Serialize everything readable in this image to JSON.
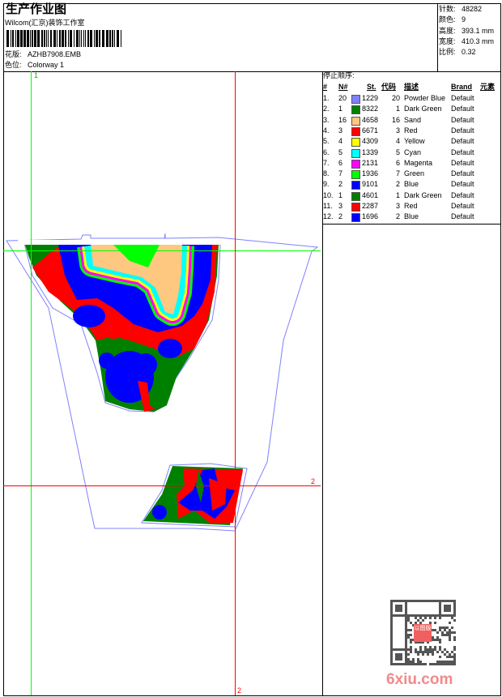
{
  "header": {
    "title": "生产作业图",
    "company": "Wilcom(汇京)装饰工作室",
    "design_label": "花版:",
    "design_value": "AZHB7908.EMB",
    "colorway_label": "色位:",
    "colorway_value": "Colorway 1"
  },
  "stats": [
    {
      "label": "针数:",
      "value": "48282"
    },
    {
      "label": "颜色:",
      "value": "9"
    },
    {
      "label": "高度:",
      "value": "393.1 mm"
    },
    {
      "label": "宽度:",
      "value": "410.3 mm"
    },
    {
      "label": "比例:",
      "value": "0.32"
    }
  ],
  "stop_sequence": {
    "title": "停止顺序:",
    "headers": [
      "#",
      "N#",
      "St.",
      "代码",
      "描述",
      "Brand",
      "元素"
    ],
    "rows": [
      {
        "idx": "1.",
        "n": "20",
        "color": "#8080ff",
        "st": "1229",
        "code": "20",
        "desc": "Powder Blue",
        "brand": "Default"
      },
      {
        "idx": "2.",
        "n": "1",
        "color": "#008000",
        "st": "8322",
        "code": "1",
        "desc": "Dark Green",
        "brand": "Default"
      },
      {
        "idx": "3.",
        "n": "16",
        "color": "#ffc880",
        "st": "4658",
        "code": "16",
        "desc": "Sand",
        "brand": "Default"
      },
      {
        "idx": "4.",
        "n": "3",
        "color": "#ff0000",
        "st": "6671",
        "code": "3",
        "desc": "Red",
        "brand": "Default"
      },
      {
        "idx": "5.",
        "n": "4",
        "color": "#ffff00",
        "st": "4309",
        "code": "4",
        "desc": "Yellow",
        "brand": "Default"
      },
      {
        "idx": "6.",
        "n": "5",
        "color": "#00ffff",
        "st": "1339",
        "code": "5",
        "desc": "Cyan",
        "brand": "Default"
      },
      {
        "idx": "7.",
        "n": "6",
        "color": "#ff00ff",
        "st": "2131",
        "code": "6",
        "desc": "Magenta",
        "brand": "Default"
      },
      {
        "idx": "8.",
        "n": "7",
        "color": "#00ff00",
        "st": "1936",
        "code": "7",
        "desc": "Green",
        "brand": "Default"
      },
      {
        "idx": "9.",
        "n": "2",
        "color": "#0000ff",
        "st": "9101",
        "code": "2",
        "desc": "Blue",
        "brand": "Default"
      },
      {
        "idx": "10.",
        "n": "1",
        "color": "#008000",
        "st": "4601",
        "code": "1",
        "desc": "Dark Green",
        "brand": "Default"
      },
      {
        "idx": "11.",
        "n": "3",
        "color": "#ff0000",
        "st": "2287",
        "code": "3",
        "desc": "Red",
        "brand": "Default"
      },
      {
        "idx": "12.",
        "n": "2",
        "color": "#0000ff",
        "st": "1696",
        "code": "2",
        "desc": "Blue",
        "brand": "Default"
      }
    ]
  },
  "guides": {
    "v1_label": "1",
    "v2_label": "2",
    "h2_label": "2"
  },
  "watermark": {
    "stamp": "以图版",
    "site": "6xiu.com"
  }
}
